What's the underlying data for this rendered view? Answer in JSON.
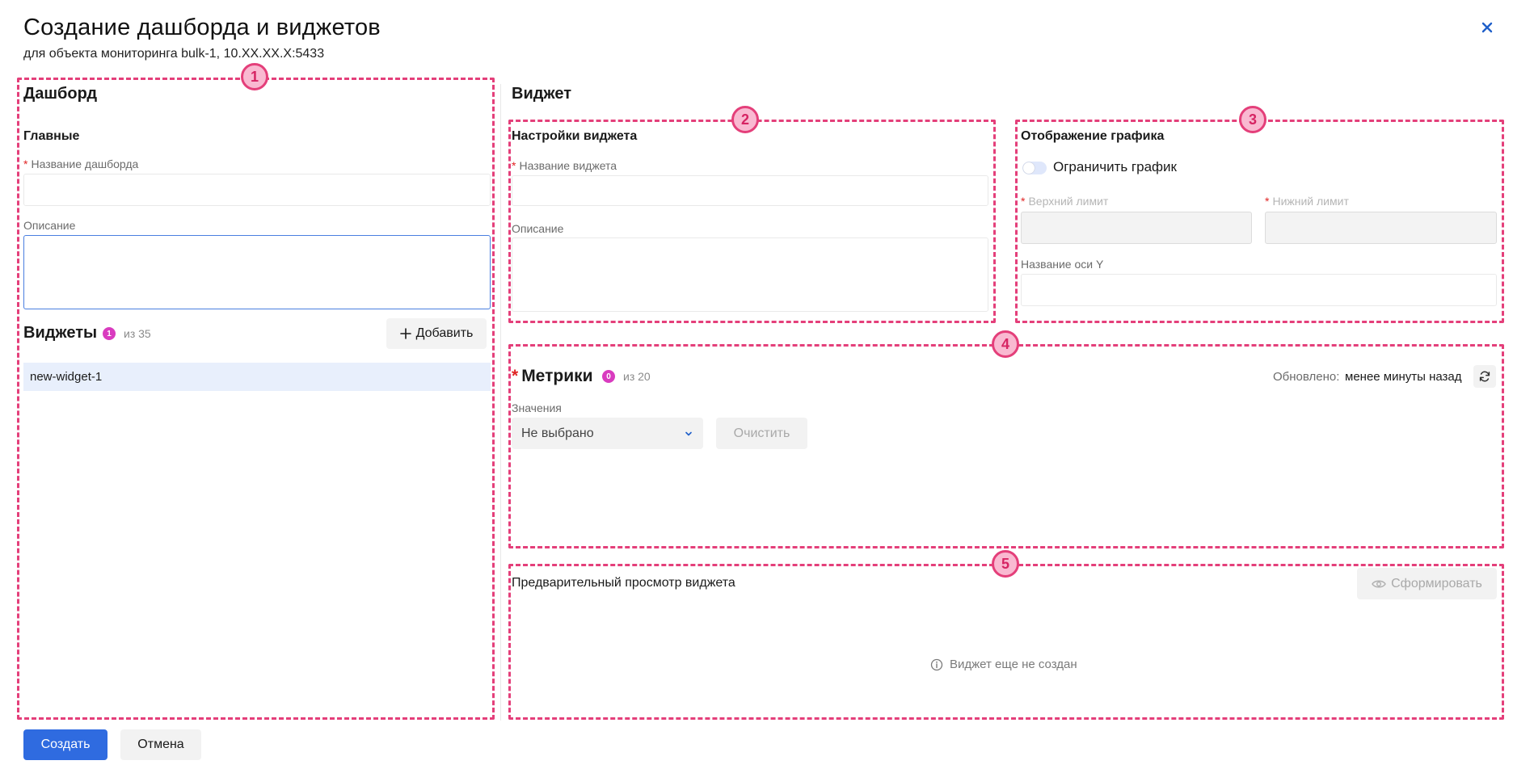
{
  "header": {
    "title": "Создание дашборда и виджетов",
    "subtitle": "для объекта мониторинга bulk-1, 10.XX.XX.X:5433"
  },
  "annotations": [
    "1",
    "2",
    "3",
    "4",
    "5"
  ],
  "dashboard": {
    "section_title": "Дашборд",
    "main_title": "Главные",
    "name_label": "Название дашборда",
    "name_value": "",
    "description_label": "Описание",
    "description_value": "",
    "widgets_title": "Виджеты",
    "widgets_count": "1",
    "widgets_total": "из 35",
    "add_label": "Добавить",
    "widget_items": [
      "new-widget-1"
    ]
  },
  "widget": {
    "section_title": "Виджет",
    "settings_title": "Настройки виджета",
    "name_label": "Название виджета",
    "name_value": "",
    "description_label": "Описание",
    "description_value": ""
  },
  "chart_display": {
    "title": "Отображение графика",
    "limit_toggle_label": "Ограничить график",
    "limit_toggle_on": false,
    "upper_limit_label": "Верхний лимит",
    "lower_limit_label": "Нижний лимит",
    "y_axis_label": "Название оси Y"
  },
  "metrics": {
    "title": "Метрики",
    "count": "0",
    "total": "из 20",
    "updated_label": "Обновлено:",
    "updated_value": "менее минуты назад",
    "values_label": "Значения",
    "select_value": "Не выбрано",
    "clear_label": "Очистить"
  },
  "preview": {
    "title": "Предварительный просмотр виджета",
    "generate_label": "Сформировать",
    "empty_text": "Виджет еще не создан"
  },
  "footer": {
    "create_label": "Создать",
    "cancel_label": "Отмена"
  },
  "colors": {
    "accent": "#2f6be0",
    "annotation": "#e43f7a",
    "badge": "#d93bbf",
    "required": "#e02424"
  },
  "icons": [
    "close-icon",
    "plus-icon",
    "chevron-down-icon",
    "refresh-icon",
    "eye-icon",
    "info-icon"
  ]
}
